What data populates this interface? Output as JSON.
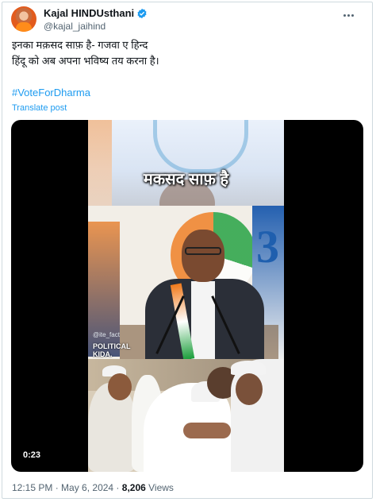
{
  "author": {
    "name": "Kajal HINDUsthani",
    "handle": "@kajal_jaihind"
  },
  "tweet": {
    "line1": "इनका मक़सद साफ़ है- गजवा ए हिन्द",
    "line2": "हिंदू को अब अपना भविष्य तय करना है।",
    "hashtag": "#VoteForDharma",
    "translate": "Translate post"
  },
  "video": {
    "caption": "मकसद साफ़ है",
    "watermark": "@ite_fact",
    "brand_line1": "POLITICAL",
    "brand_line2": "KIDA.",
    "duration": "0:23"
  },
  "footer": {
    "time": "12:15 PM",
    "sep1": " · ",
    "date": "May 6, 2024",
    "sep2": " · ",
    "views_count": "8,206",
    "views_label": " Views"
  },
  "colors": {
    "accent": "#1d9bf0",
    "muted": "#536471",
    "text": "#0f1419"
  }
}
